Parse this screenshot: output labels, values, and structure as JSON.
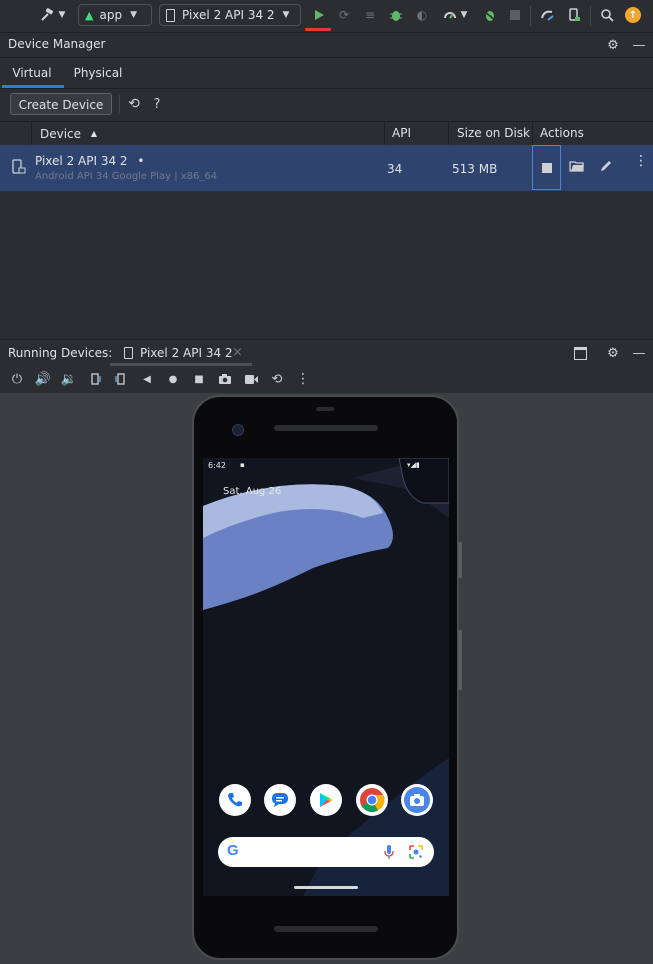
{
  "toolbar": {
    "module": "app",
    "device": "Pixel 2 API 34 2",
    "icons": [
      "hammer-icon",
      "android-icon",
      "device-icon",
      "run-icon",
      "rerun-icon",
      "logcat-icon",
      "debug-icon",
      "attach-debugger-icon",
      "profile-icon",
      "stop-icon",
      "sync-icon",
      "device-manager-icon",
      "search-icon",
      "update-icon"
    ]
  },
  "device_manager": {
    "title": "Device Manager",
    "tabs": [
      "Virtual",
      "Physical"
    ],
    "create_button": "Create Device",
    "refresh_icon": "refresh-icon",
    "help": "?",
    "columns": {
      "device": "Device",
      "api": "API",
      "size": "Size on Disk",
      "actions": "Actions"
    },
    "sort_indicator": "▲",
    "rows": [
      {
        "name": "Pixel 2 API 34 2",
        "status_dot": "•",
        "subtitle": "Android API 34 Google Play | x86_64",
        "api": "34",
        "size": "513 MB"
      }
    ]
  },
  "running_devices": {
    "label": "Running Devices:",
    "tab": "Pixel 2 API 34 2",
    "close": "×"
  },
  "phone": {
    "time": "6:42",
    "date": "Sat, Aug 26",
    "apps": [
      "phone-app-icon",
      "messages-app-icon",
      "play-store-app-icon",
      "chrome-app-icon",
      "camera-app-icon"
    ],
    "search_g": "G"
  },
  "colors": {
    "accent": "#2e436e",
    "run": "#5fb865",
    "bg": "#2b2d30",
    "update": "#f0a732"
  }
}
